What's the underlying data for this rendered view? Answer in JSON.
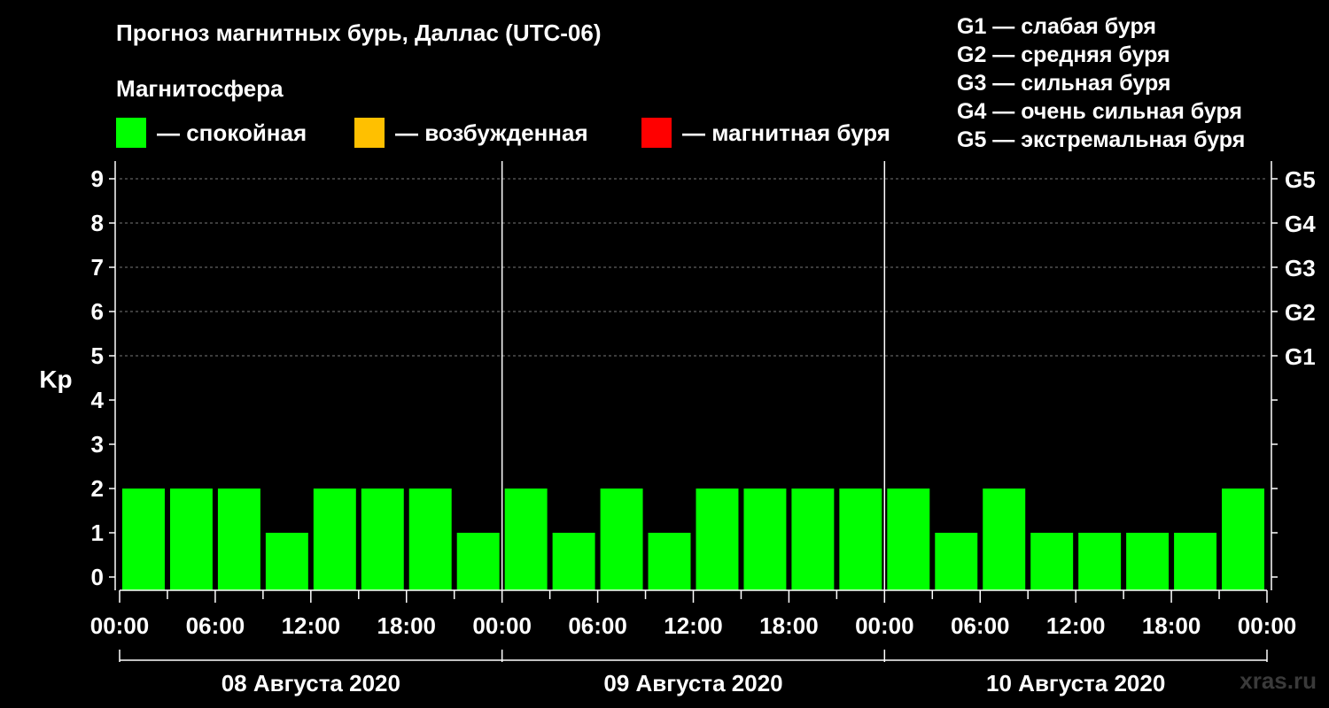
{
  "chart_data": {
    "type": "bar",
    "title": "Прогноз магнитных бурь, Даллас (UTC-06)",
    "subtitle": "Магнитосфера",
    "ylabel": "Kp",
    "ylim": [
      0,
      9
    ],
    "yticks": [
      "0",
      "1",
      "2",
      "3",
      "4",
      "5",
      "6",
      "7",
      "8",
      "9"
    ],
    "right_ticks": [
      {
        "kp": 5,
        "label": "G1"
      },
      {
        "kp": 6,
        "label": "G2"
      },
      {
        "kp": 7,
        "label": "G3"
      },
      {
        "kp": 8,
        "label": "G4"
      },
      {
        "kp": 9,
        "label": "G5"
      }
    ],
    "xticks": [
      "00:00",
      "06:00",
      "12:00",
      "18:00",
      "00:00",
      "06:00",
      "12:00",
      "18:00",
      "00:00",
      "06:00",
      "12:00",
      "18:00",
      "00:00"
    ],
    "days": [
      "08 Августа 2020",
      "09 Августа 2020",
      "10 Августа 2020"
    ],
    "intervals_per_day": 8,
    "values": [
      2,
      2,
      2,
      1,
      2,
      2,
      2,
      1,
      2,
      1,
      2,
      1,
      2,
      2,
      2,
      2,
      2,
      1,
      2,
      1,
      1,
      1,
      1,
      2
    ],
    "grid": "dashed horizontal at each Kp level from 5 to 9",
    "legend": [
      {
        "label": "— спокойная",
        "color": "#00ff00"
      },
      {
        "label": "— возбужденная",
        "color": "#ffc000"
      },
      {
        "label": "— магнитная буря",
        "color": "#ff0000"
      }
    ],
    "g_scale": [
      "G1 — слабая буря",
      "G2 — средняя буря",
      "G3 — сильная буря",
      "G4 — очень сильная буря",
      "G5 — экстремальная буря"
    ],
    "bar_color": "#00ff00"
  },
  "watermark": "xras.ru"
}
